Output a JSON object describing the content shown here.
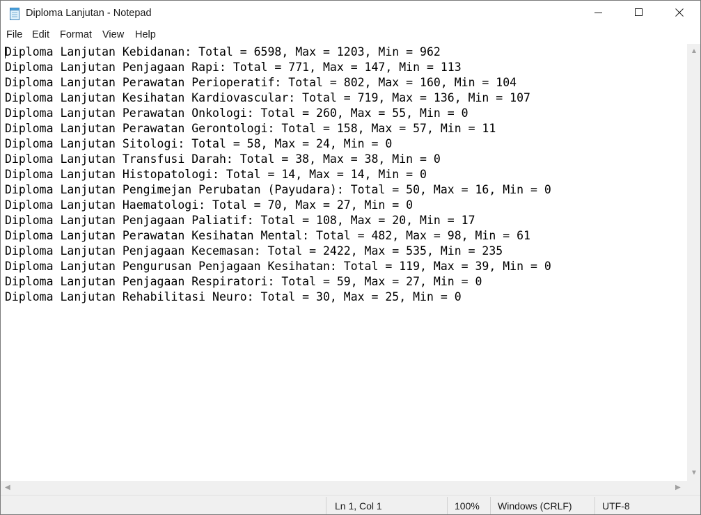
{
  "window": {
    "title": "Diploma Lanjutan - Notepad",
    "icon": "notepad-icon",
    "controls": [
      "minimize-icon",
      "maximize-icon",
      "close-icon"
    ]
  },
  "menu": {
    "file": "File",
    "edit": "Edit",
    "format": "Format",
    "view": "View",
    "help": "Help"
  },
  "editor": {
    "lines": [
      "Diploma Lanjutan Kebidanan: Total = 6598, Max = 1203, Min = 962",
      "Diploma Lanjutan Penjagaan Rapi: Total = 771, Max = 147, Min = 113",
      "Diploma Lanjutan Perawatan Perioperatif: Total = 802, Max = 160, Min = 104",
      "Diploma Lanjutan Kesihatan Kardiovascular: Total = 719, Max = 136, Min = 107",
      "Diploma Lanjutan Perawatan Onkologi: Total = 260, Max = 55, Min = 0",
      "Diploma Lanjutan Perawatan Gerontologi: Total = 158, Max = 57, Min = 11",
      "Diploma Lanjutan Sitologi: Total = 58, Max = 24, Min = 0",
      "Diploma Lanjutan Transfusi Darah: Total = 38, Max = 38, Min = 0",
      "Diploma Lanjutan Histopatologi: Total = 14, Max = 14, Min = 0",
      "Diploma Lanjutan Pengimejan Perubatan (Payudara): Total = 50, Max = 16, Min = 0",
      "Diploma Lanjutan Haematologi: Total = 70, Max = 27, Min = 0",
      "Diploma Lanjutan Penjagaan Paliatif: Total = 108, Max = 20, Min = 17",
      "Diploma Lanjutan Perawatan Kesihatan Mental: Total = 482, Max = 98, Min = 61",
      "Diploma Lanjutan Penjagaan Kecemasan: Total = 2422, Max = 535, Min = 235",
      "Diploma Lanjutan Pengurusan Penjagaan Kesihatan: Total = 119, Max = 39, Min = 0",
      "Diploma Lanjutan Penjagaan Respiratori: Total = 59, Max = 27, Min = 0",
      "Diploma Lanjutan Rehabilitasi Neuro: Total = 30, Max = 25, Min = 0"
    ]
  },
  "status": {
    "position": "Ln 1, Col 1",
    "zoom": "100%",
    "line_ending": "Windows (CRLF)",
    "encoding": "UTF-8"
  }
}
